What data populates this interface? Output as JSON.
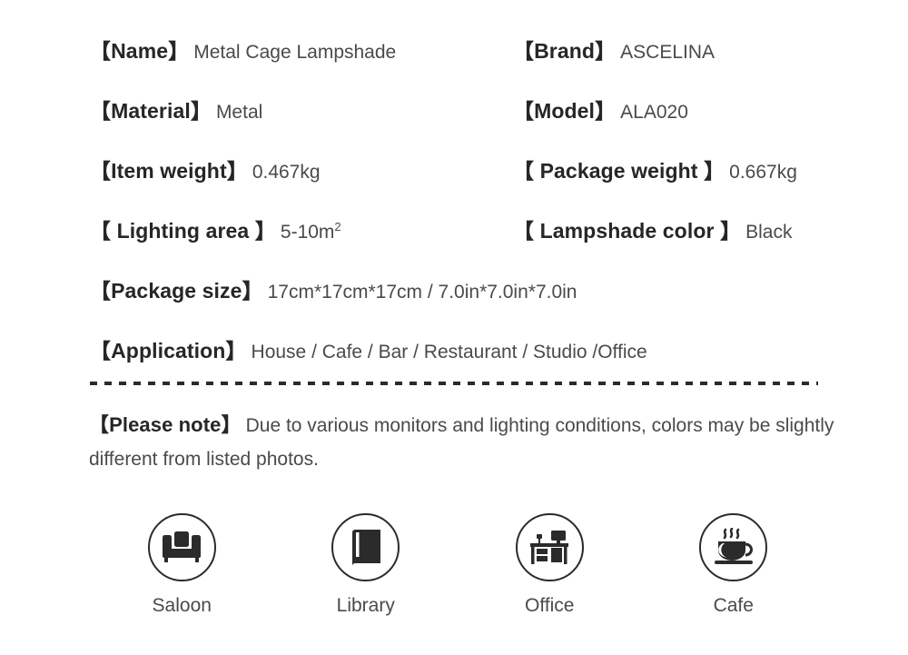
{
  "specs": {
    "rows": [
      {
        "left": {
          "label": "【Name】",
          "value": "Metal Cage Lampshade"
        },
        "right": {
          "label": "【Brand】",
          "value": "ASCELINA"
        }
      },
      {
        "left": {
          "label": "【Material】",
          "value": "Metal"
        },
        "right": {
          "label": "【Model】",
          "value": "ALA020"
        }
      },
      {
        "left": {
          "label": "【Item weight】",
          "value": "0.467kg"
        },
        "right": {
          "label": "【 Package weight 】",
          "value": "0.667kg"
        }
      },
      {
        "left": {
          "label": "【 Lighting area 】",
          "value": "5-10m",
          "sup": "2"
        },
        "right": {
          "label": "【 Lampshade color 】",
          "value": "Black"
        }
      }
    ],
    "package_size": {
      "label": "【Package size】",
      "value": "17cm*17cm*17cm / 7.0in*7.0in*7.0in"
    },
    "application": {
      "label": "【Application】",
      "value": "House / Cafe / Bar / Restaurant / Studio /Office"
    }
  },
  "note": {
    "label": "【Please note】",
    "text": "Due to various monitors and lighting conditions, colors may be slightly different from listed photos."
  },
  "scenes": [
    {
      "label": "Saloon",
      "icon": "armchair-icon"
    },
    {
      "label": "Library",
      "icon": "book-icon"
    },
    {
      "label": "Office",
      "icon": "desk-icon"
    },
    {
      "label": "Cafe",
      "icon": "coffee-cup-icon"
    }
  ],
  "colors": {
    "label_text": "#262626",
    "value_text": "#4a4a4a",
    "icon_stroke": "#2b2b2b",
    "background": "#ffffff"
  }
}
